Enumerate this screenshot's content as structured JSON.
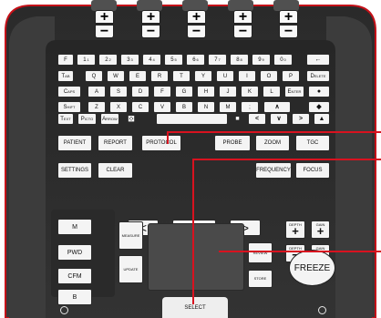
{
  "colors": {
    "leader": "#d8121f",
    "panel": "#2d2d2d",
    "key": "#f4f4f4",
    "trackpad": "#4a4a4a"
  },
  "tgc": [
    {
      "plus": "+",
      "minus": "−"
    },
    {
      "plus": "+",
      "minus": "−"
    },
    {
      "plus": "+",
      "minus": "−"
    },
    {
      "plus": "+",
      "minus": "−"
    },
    {
      "plus": "+",
      "minus": "−"
    }
  ],
  "keyboard": {
    "row1": [
      {
        "label": "F"
      },
      {
        "label": "1",
        "sup": "1"
      },
      {
        "label": "2",
        "sup": "2"
      },
      {
        "label": "3",
        "sup": "3"
      },
      {
        "label": "4",
        "sup": "4"
      },
      {
        "label": "5",
        "sup": "5"
      },
      {
        "label": "6",
        "sup": "6"
      },
      {
        "label": "7",
        "sup": "7"
      },
      {
        "label": "8",
        "sup": "8"
      },
      {
        "label": "9",
        "sup": "9"
      },
      {
        "label": "0",
        "sup": "0"
      },
      {
        "label": "←"
      }
    ],
    "row2": [
      "Tab",
      "Q",
      "W",
      "E",
      "R",
      "T",
      "Y",
      "U",
      "I",
      "O",
      "P",
      "Delete"
    ],
    "row3": [
      "Caps",
      "A",
      "S",
      "D",
      "F",
      "G",
      "H",
      "J",
      "K",
      "L",
      "Enter",
      "●"
    ],
    "row4": [
      "Shift",
      "Z",
      "X",
      "C",
      "V",
      "B",
      "N",
      "M",
      ";",
      "∧",
      "◆"
    ],
    "row5": {
      "text": "Text",
      "picto": "Picto",
      "arrow": "Arrow",
      "x_box": "⊠",
      "square": "■",
      "left": "<",
      "down": "∨",
      "right": ">",
      "up": "▲"
    }
  },
  "function_keys": {
    "patient": "PATIENT",
    "report": "REPORT",
    "protocol": "PROTOCOL",
    "probe": "PROBE",
    "zoom": "ZOOM",
    "tgc": "TGC",
    "settings": "SETTINGS",
    "clear": "CLEAR",
    "frequency": "FREQUENCY",
    "focus": "FOCUS"
  },
  "mode_keys": [
    "M",
    "PWD",
    "CFM",
    "B"
  ],
  "cineloop": {
    "left": "<",
    "label": "CINELOOP",
    "right": ">"
  },
  "depth": {
    "label": "DEPTH",
    "plus": "+",
    "minus": "−"
  },
  "gain": {
    "label": "GAIN",
    "plus": "+",
    "minus": "−"
  },
  "side_keys": {
    "measure": "MEASURE",
    "update": "UPDATE",
    "review": "REVIEW",
    "store": "STORE"
  },
  "freeze": "FREEZE",
  "select": "SELECT"
}
